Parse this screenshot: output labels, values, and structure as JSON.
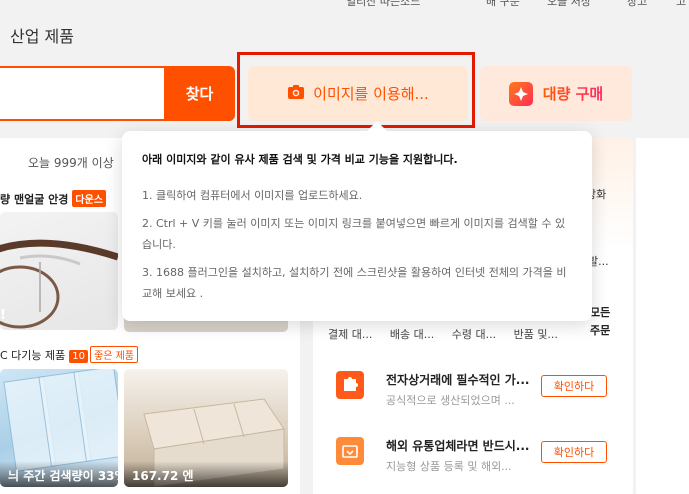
{
  "top_nav": [
    "얼리산 따는소느",
    "배 구문",
    "오늘 처상",
    "장고",
    "고"
  ],
  "category_title": "산업 제품",
  "search": {
    "placeholder": "",
    "button_label": "찾다"
  },
  "image_search": {
    "label": "이미지를 이용해..."
  },
  "bulk_buy": {
    "label": "대량 구매"
  },
  "left": {
    "today_text": "오늘 999개 이상",
    "product1": {
      "title": "량 맨얼굴 안경",
      "tag": "다운스"
    },
    "product2": {
      "title": "C 다기능 제품",
      "tag_num": "10",
      "tag_label": "좋은 제품"
    },
    "overlay1": "!",
    "overlay2": "늬 주간 검색량이 33%",
    "overlay3": "167.72 엔"
  },
  "tooltip": {
    "title": "아래 이미지와 같이 유사 제품 검색 및 가격 비교 기능을 지원합니다.",
    "items": [
      "1. 클릭하여 컴퓨터에서 이미지를 업로드하세요.",
      "2. Ctrl + V 키를 눌러 이미지 또는 이미지 링크를 붙여넣으면 빠르게 이미지를 검색할 수 있습니다.",
      "3. 1688 플러그인을 설치하고, 설치하기 전에 스크린샷을 활용하여 인터넷 전체의 가격을 비교해 보세요 ."
    ]
  },
  "right": {
    "filters": [
      "결제 대...",
      "배송 대...",
      "수령 대...",
      "반품 및..."
    ],
    "all_orders": [
      "모든",
      "주문"
    ],
    "side_texts": [
      "상화",
      "발..."
    ],
    "services": [
      {
        "title": "전자상거래에 필수적인 가...",
        "subtitle": "공식적으로 생산되었으며 ...",
        "button": "확인하다",
        "icon": "puzzle-icon"
      },
      {
        "title": "해외 유통업체라면 반드시...",
        "subtitle": "지능형 상품 등록 및 해외...",
        "button": "확인하다",
        "icon": "upload-box-icon"
      }
    ]
  },
  "colors": {
    "accent": "#ff5000",
    "highlight_border": "#e21b00",
    "image_btn_bg": "#ffe8d6"
  }
}
